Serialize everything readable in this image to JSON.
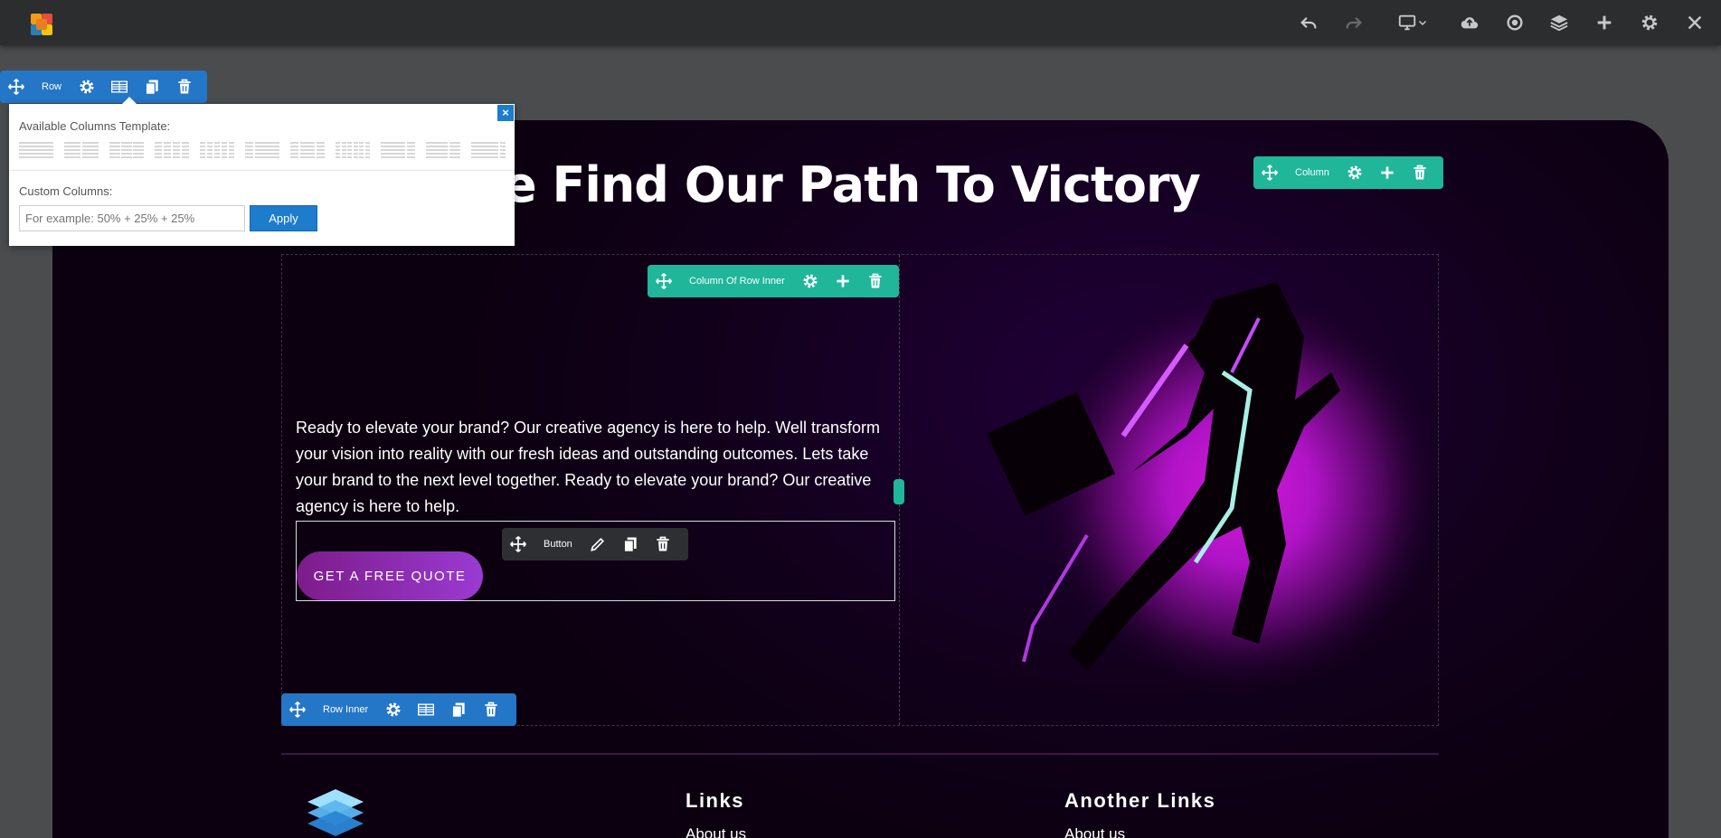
{
  "hero": {
    "title": "e Run, We Find Our Path To Victory"
  },
  "content": {
    "body": "Ready to elevate your brand? Our creative agency is here to help. Well transform your vision into reality with our fresh ideas and outstanding outcomes. Lets take your brand to the next level together. Ready to elevate your brand? Our creative agency is here to help.",
    "button_label": "GET A FREE QUOTE"
  },
  "footer": {
    "col1_heading": "Links",
    "col1_link": "About us",
    "col2_heading": "Another Links",
    "col2_link": "About us"
  },
  "editor": {
    "row_label": "Row",
    "column_label": "Column",
    "column_inner_label": "Column Of Row Inner",
    "button_label": "Button",
    "row_inner_label": "Row Inner"
  },
  "popup": {
    "templates_label": "Available Columns Template:",
    "custom_label": "Custom Columns:",
    "input_placeholder": "For example: 50% + 25% + 25%",
    "apply_label": "Apply",
    "close_label": "×"
  },
  "colors": {
    "accent_blue": "#2476c7",
    "accent_teal": "#1fb69a",
    "button_gradient": [
      "#7c1c8a",
      "#9a3bd2"
    ],
    "glow": "#c21bd8"
  },
  "icons": [
    "logo-icon",
    "undo-icon",
    "redo-icon",
    "desktop-icon",
    "chevron-down-icon",
    "cloud-upload-icon",
    "preview-icon",
    "layers-icon",
    "plus-icon",
    "gear-icon",
    "close-icon",
    "move-icon",
    "columns-icon",
    "copy-icon",
    "trash-icon",
    "pencil-icon"
  ]
}
